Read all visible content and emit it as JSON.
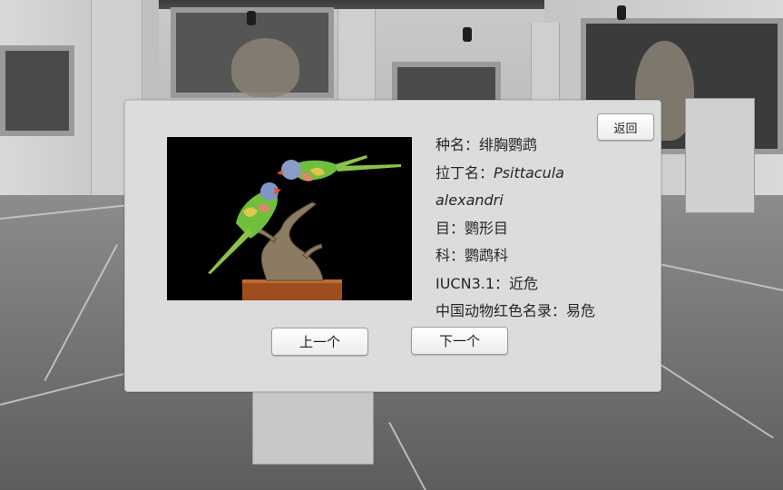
{
  "panel": {
    "back_button": "返回",
    "prev_button": "上一个",
    "next_button": "下一个"
  },
  "species": {
    "species_name_label": "种名：",
    "species_name": "绯胸鹦鹉",
    "latin_label": "拉丁名：",
    "latin_part1": "Psittacula",
    "latin_part2": "alexandri",
    "order_label": "目：",
    "order": "鹦形目",
    "family_label": "科：",
    "family": "鹦鹉科",
    "iucn_label": "IUCN3.1：",
    "iucn": "近危",
    "china_red_list_label": "中国动物红色名录：",
    "china_red_list": "易危"
  },
  "colors": {
    "panel_bg": "#dcdcdc",
    "photo_bg": "#000000",
    "parrot_green": "#6fbf3c",
    "parrot_head": "#7f96c4",
    "beak": "#e3503a",
    "base_wood": "#9c4e1e"
  },
  "icons": {
    "photo": "parrot-specimen-photo"
  }
}
